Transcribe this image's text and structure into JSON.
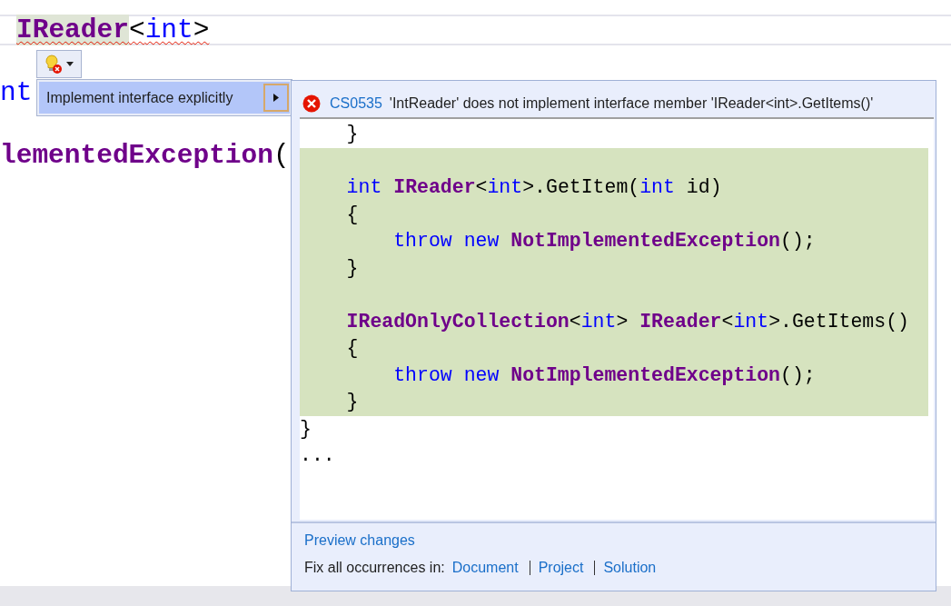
{
  "editor": {
    "lines": [
      {
        "current": true,
        "error": true,
        "tokens": [
          {
            "text": "IReader",
            "kind": "type",
            "highlighted": true
          },
          {
            "text": "<",
            "kind": "plain",
            "highlighted": false
          },
          {
            "text": "int",
            "kind": "keyword",
            "highlighted": false
          },
          {
            "text": ">",
            "kind": "plain",
            "highlighted": false
          }
        ]
      },
      {
        "current": false,
        "error": false,
        "tokens": [
          {
            "text": "nt",
            "kind": "keyword",
            "highlighted": false
          }
        ]
      },
      {
        "current": false,
        "error": false,
        "tokens": [
          {
            "text": "lementedException",
            "kind": "type",
            "highlighted": false
          },
          {
            "text": "(",
            "kind": "plain",
            "highlighted": false
          }
        ]
      }
    ]
  },
  "menu": {
    "items": [
      {
        "label": "Implement interface explicitly",
        "selected": true,
        "has_submenu": true
      }
    ]
  },
  "preview": {
    "error_code": "CS0535",
    "message": "'IntReader' does not implement interface member 'IReader<int>.GetItems()'",
    "code_lines": [
      {
        "added": false,
        "tokens": [
          {
            "text": "    }",
            "kind": "plain"
          }
        ]
      },
      {
        "added": true
      },
      {
        "added": true,
        "tokens": [
          {
            "text": "    int",
            "kind": "keyword"
          },
          {
            "text": " IReader",
            "kind": "type"
          },
          {
            "text": "<",
            "kind": "plain"
          },
          {
            "text": "int",
            "kind": "keyword"
          },
          {
            "text": ">.GetItem(",
            "kind": "plain"
          },
          {
            "text": "int",
            "kind": "keyword"
          },
          {
            "text": " id)",
            "kind": "plain"
          }
        ]
      },
      {
        "added": true,
        "tokens": [
          {
            "text": "    {",
            "kind": "plain"
          }
        ]
      },
      {
        "added": true,
        "tokens": [
          {
            "text": "        throw",
            "kind": "keyword"
          },
          {
            "text": " new",
            "kind": "keyword"
          },
          {
            "text": " NotImplementedException",
            "kind": "type"
          },
          {
            "text": "();",
            "kind": "plain"
          }
        ]
      },
      {
        "added": true,
        "tokens": [
          {
            "text": "    }",
            "kind": "plain"
          }
        ]
      },
      {
        "added": true
      },
      {
        "added": true,
        "tokens": [
          {
            "text": "    IReadOnlyCollection",
            "kind": "type"
          },
          {
            "text": "<",
            "kind": "plain"
          },
          {
            "text": "int",
            "kind": "keyword"
          },
          {
            "text": ">",
            "kind": "plain"
          },
          {
            "text": " IReader",
            "kind": "type"
          },
          {
            "text": "<",
            "kind": "plain"
          },
          {
            "text": "int",
            "kind": "keyword"
          },
          {
            "text": ">.GetItems()",
            "kind": "plain"
          }
        ]
      },
      {
        "added": true,
        "tokens": [
          {
            "text": "    {",
            "kind": "plain"
          }
        ]
      },
      {
        "added": true,
        "tokens": [
          {
            "text": "        throw",
            "kind": "keyword"
          },
          {
            "text": " new",
            "kind": "keyword"
          },
          {
            "text": " NotImplementedException",
            "kind": "type"
          },
          {
            "text": "();",
            "kind": "plain"
          }
        ]
      },
      {
        "added": true,
        "tokens": [
          {
            "text": "    }",
            "kind": "plain"
          }
        ]
      },
      {
        "added": false,
        "tokens": [
          {
            "text": "}",
            "kind": "plain"
          }
        ]
      },
      {
        "added": false,
        "tokens": [
          {
            "text": "...",
            "kind": "plain"
          }
        ]
      }
    ],
    "preview_link": "Preview changes",
    "fix_label": "Fix all occurrences in:",
    "fix_links": [
      "Document",
      "Project",
      "Solution"
    ]
  }
}
